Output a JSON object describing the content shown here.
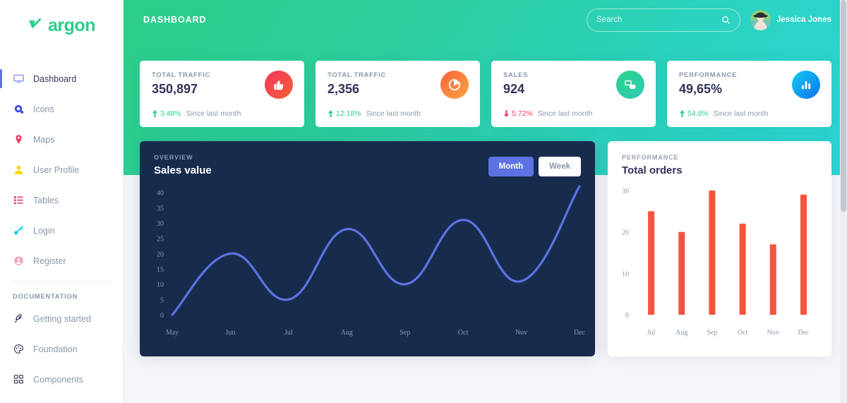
{
  "brand": {
    "name": "argon",
    "logo_icon": "argon-check-logo",
    "color": "#2DCE89"
  },
  "sidebar": {
    "items": [
      {
        "label": "Dashboard",
        "icon": "monitor-icon",
        "color": "#5E72E4",
        "active": true
      },
      {
        "label": "Icons",
        "icon": "bullseye-icon",
        "color": "#3F51E0",
        "active": false
      },
      {
        "label": "Maps",
        "icon": "map-pin-icon",
        "color": "#F5365C",
        "active": false
      },
      {
        "label": "User Profile",
        "icon": "user-icon",
        "color": "#FFD600",
        "active": false
      },
      {
        "label": "Tables",
        "icon": "list-icon",
        "color": "#F5365C",
        "active": false
      },
      {
        "label": "Login",
        "icon": "key-icon",
        "color": "#11CDEF",
        "active": false
      },
      {
        "label": "Register",
        "icon": "user-circle-icon",
        "color": "#F3A4B5",
        "active": false
      }
    ],
    "section_heading": "DOCUMENTATION",
    "doc_items": [
      {
        "label": "Getting started",
        "icon": "rocket-icon",
        "color": "#32325d"
      },
      {
        "label": "Foundation",
        "icon": "palette-icon",
        "color": "#32325d"
      },
      {
        "label": "Components",
        "icon": "components-icon",
        "color": "#32325d"
      }
    ]
  },
  "header": {
    "title": "DASHBOARD",
    "search": {
      "placeholder": "Search",
      "value": "",
      "icon": "search-icon"
    },
    "user": {
      "name": "Jessica Jones",
      "avatar_icon": "user-avatar"
    },
    "gradient_from": "#2DCE89",
    "gradient_to": "#2BD6D6"
  },
  "stats": [
    {
      "label": "TOTAL TRAFFIC",
      "value": "350,897",
      "delta": "3.48%",
      "direction": "up",
      "since": "Since last month",
      "icon": "thumbs-up-icon",
      "icon_color_from": "#F5365C",
      "icon_color_to": "#F56036"
    },
    {
      "label": "TOTAL TRAFFIC",
      "value": "2,356",
      "delta": "12.18%",
      "direction": "up",
      "since": "Since last month",
      "icon": "pie-chart-icon",
      "icon_color_from": "#FB6340",
      "icon_color_to": "#FBB140"
    },
    {
      "label": "SALES",
      "value": "924",
      "delta": "5.72%",
      "direction": "down",
      "since": "Since last month",
      "icon": "money-icon",
      "icon_color_from": "#2DCE89",
      "icon_color_to": "#2DCEB0"
    },
    {
      "label": "PERFORMANCE",
      "value": "49,65%",
      "delta": "54.8%",
      "direction": "up",
      "since": "Since last month",
      "icon": "bar-chart-icon",
      "icon_color_from": "#11CDEF",
      "icon_color_to": "#1171EF"
    }
  ],
  "overview_card": {
    "eyebrow": "OVERVIEW",
    "title": "Sales value",
    "toggle": {
      "active_label": "Month",
      "inactive_label": "Week",
      "active_color": "#5E72E4"
    }
  },
  "performance_card": {
    "eyebrow": "PERFORMANCE",
    "title": "Total orders"
  },
  "chart_data": [
    {
      "type": "line",
      "title": "Sales value",
      "subtitle": "OVERVIEW",
      "xlabel": "",
      "ylabel": "",
      "categories": [
        "May",
        "Jun",
        "Jul",
        "Aug",
        "Sep",
        "Oct",
        "Nov",
        "Dec"
      ],
      "series": [
        {
          "name": "Sales value",
          "values": [
            0,
            20,
            5,
            28,
            10,
            31,
            11,
            42
          ],
          "color": "#5E72E4"
        }
      ],
      "ylim": [
        0,
        42
      ],
      "yticks": [
        0,
        5,
        10,
        15,
        20,
        25,
        30,
        35,
        40
      ],
      "grid": false,
      "legend": "none",
      "background": "#172B4D",
      "smooth": true
    },
    {
      "type": "bar",
      "title": "Total orders",
      "subtitle": "PERFORMANCE",
      "xlabel": "",
      "ylabel": "",
      "categories": [
        "Jul",
        "Aug",
        "Sep",
        "Oct",
        "Nov",
        "Dec"
      ],
      "values": [
        25,
        20,
        30,
        22,
        17,
        29
      ],
      "ylim": [
        0,
        31
      ],
      "yticks": [
        0,
        10,
        20,
        30
      ],
      "grid": false,
      "legend": "none",
      "bar_color": "#F5533D",
      "background": "#FFFFFF"
    }
  ]
}
